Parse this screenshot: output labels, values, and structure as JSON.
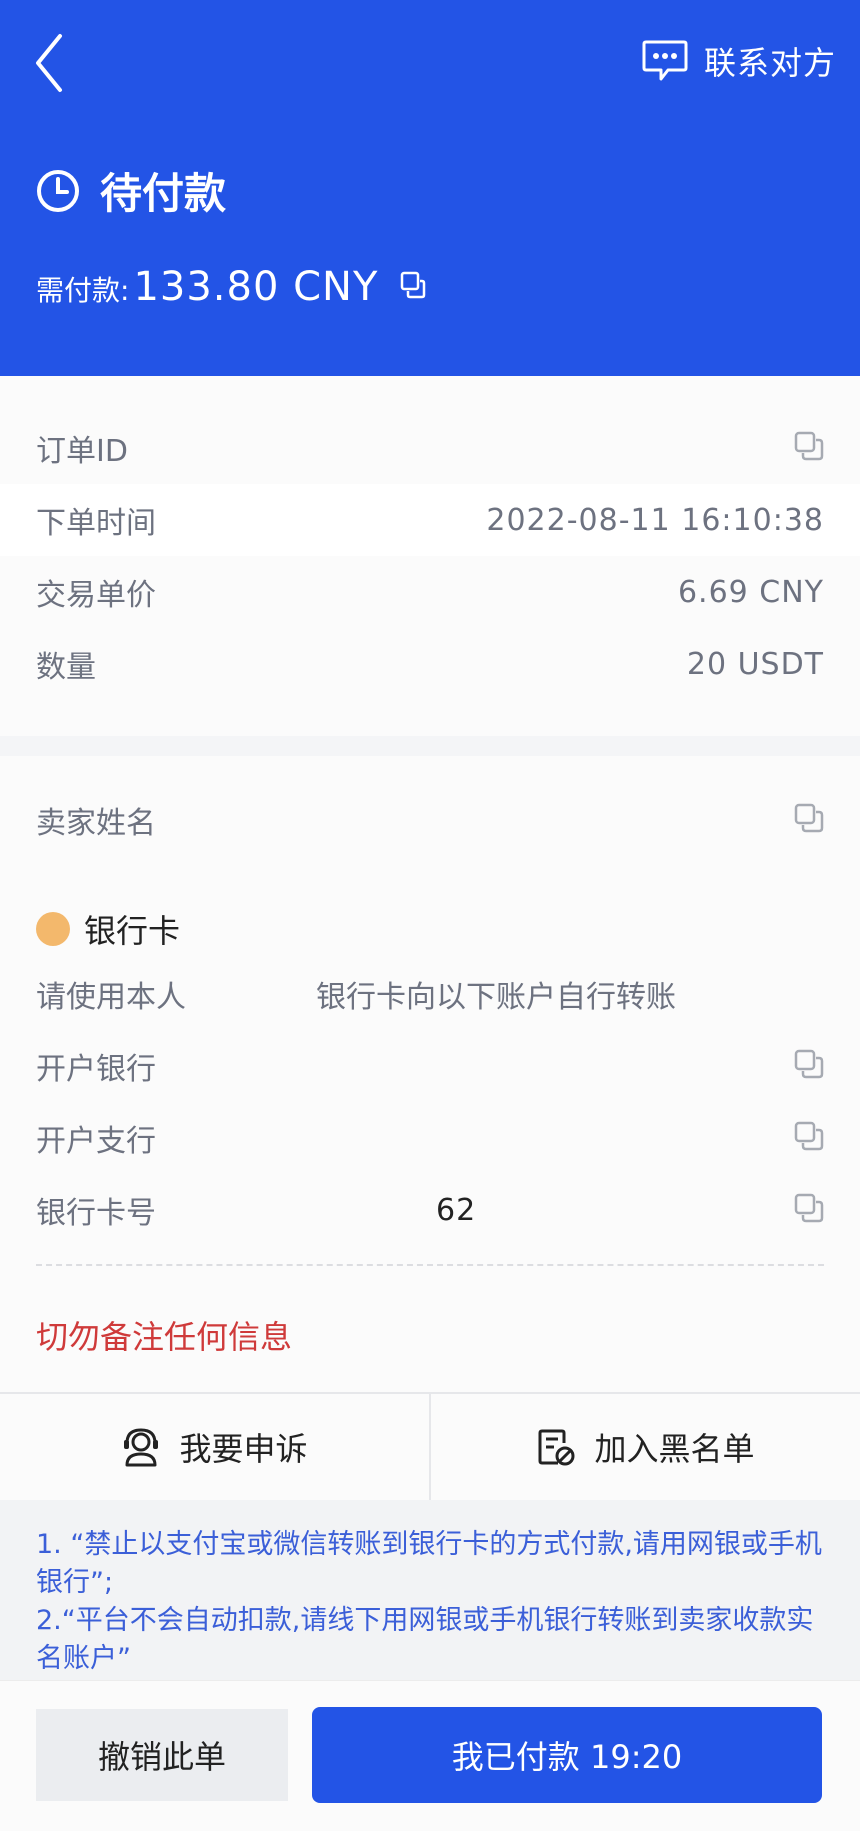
{
  "header": {
    "contact_label": "联系对方",
    "status_label": "待付款",
    "amount_label": "需付款:",
    "amount_value": "133.80 CNY"
  },
  "order_info": [
    {
      "label": "订单ID",
      "value": ""
    },
    {
      "label": "下单时间",
      "value": "2022-08-11 16:10:38"
    },
    {
      "label": "交易单价",
      "value": "6.69 CNY"
    },
    {
      "label": "数量",
      "value": "20 USDT"
    }
  ],
  "seller": {
    "name_label": "卖家姓名",
    "name_value": "",
    "payment_method": "银行卡",
    "instruction_start": "请使用本人",
    "instruction_end": "银行卡向以下账户自行转账",
    "fields": [
      {
        "label": "开户银行",
        "value": ""
      },
      {
        "label": "开户支行",
        "value": ""
      },
      {
        "label": "银行卡号",
        "value": "62"
      }
    ],
    "warning": "切勿备注任何信息"
  },
  "actions": {
    "appeal_label": "我要申诉",
    "blacklist_label": "加入黑名单"
  },
  "notes": [
    "1. “禁止以支付宝或微信转账到银行卡的方式付款,请用网银或手机银行”;",
    "2.“平台不会自动扣款,请线下用网银或手机银行转账到卖家收款实名账户”"
  ],
  "footer": {
    "cancel_label": "撤销此单",
    "paid_label": "我已付款 19:20"
  },
  "colors": {
    "primary": "#2354e6",
    "warning": "#cf3a3a",
    "note": "#3b5fd8"
  }
}
